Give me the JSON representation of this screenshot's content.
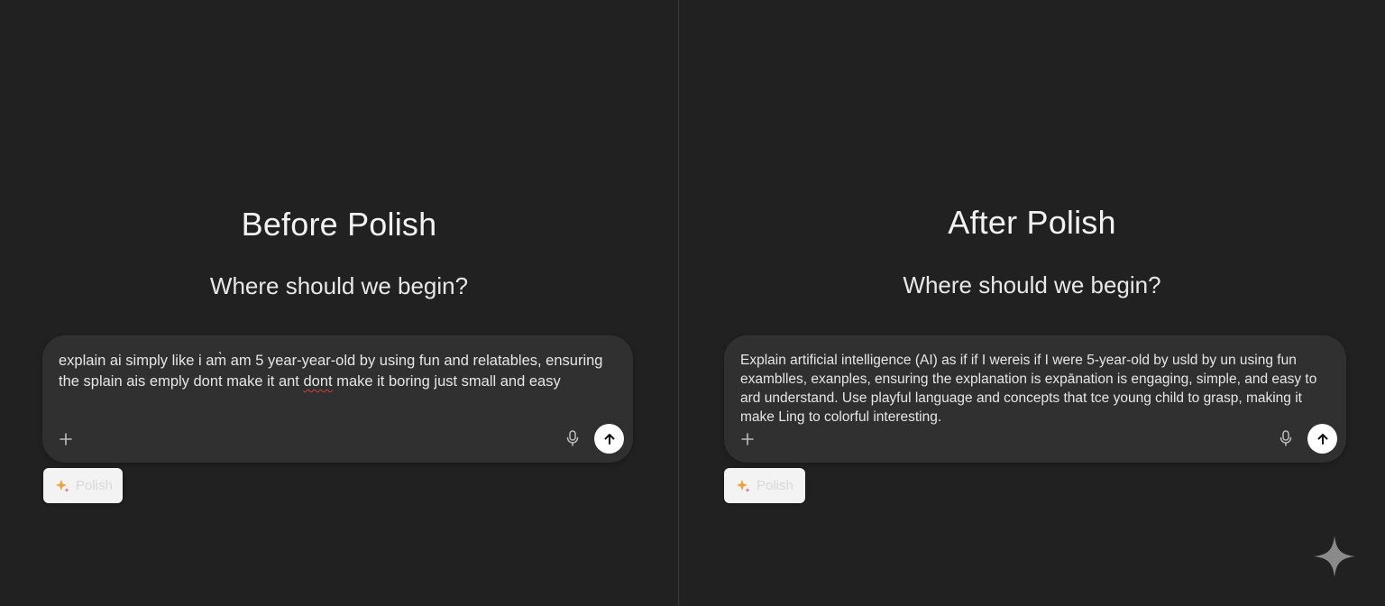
{
  "left_panel": {
    "title": "Before Polish",
    "greeting": "Where should we begin?",
    "composer": {
      "line1": "explain ai simply like i am̀ am 5 year-year-old by using fun and relatables, ensuring",
      "line2_a": "the splain ais emply dont make it ant ",
      "line2_misspelled": "dont",
      "line2_b": " make it boring just small and easy"
    },
    "polish_label": "Polish"
  },
  "right_panel": {
    "title": "After Polish",
    "greeting": "Where should we begin?",
    "composer": {
      "lines": [
        "Explain artificial intelligence (AI) as if if I wereis if I were 5-year-old by usld by un using fun",
        "examblles, exanples, ensuring the explanation is expānation is engaging, simple, and easy to",
        "ard understand. Use playful language and concepts that tce young child to grasp, making it",
        "make Ling to colorful interesting."
      ]
    },
    "polish_label": "Polish"
  },
  "icons": {
    "plus": "plus-icon",
    "mic": "microphone-icon",
    "send": "arrow-up-icon",
    "polish": "sparkles-icon",
    "watermark": "four-point-sparkle-icon"
  },
  "colors": {
    "background": "#212121",
    "composer": "#303030",
    "send_button": "#ffffff",
    "polish_button": "#f3f3f3",
    "spellcheck": "#d23c3c"
  }
}
